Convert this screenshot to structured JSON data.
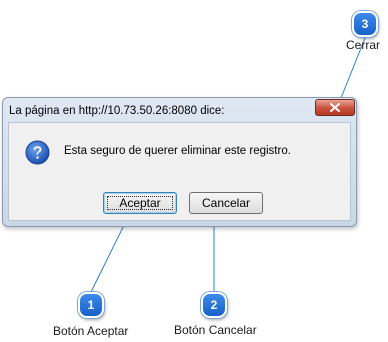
{
  "dialog": {
    "title": "La página en http://10.73.50.26:8080 dice:",
    "message": "Esta seguro de querer eliminar este registro.",
    "icon": "question-icon",
    "close_icon": "close-icon",
    "buttons": {
      "accept": "Aceptar",
      "cancel": "Cancelar"
    }
  },
  "callouts": [
    {
      "number": "1",
      "label": "Botón Aceptar"
    },
    {
      "number": "2",
      "label": "Botón Cancelar"
    },
    {
      "number": "3",
      "label": "Cerrar"
    }
  ],
  "colors": {
    "badge": "#1f6fd6",
    "close_button": "#c9503b",
    "leader_line": "#2a7fd4"
  }
}
